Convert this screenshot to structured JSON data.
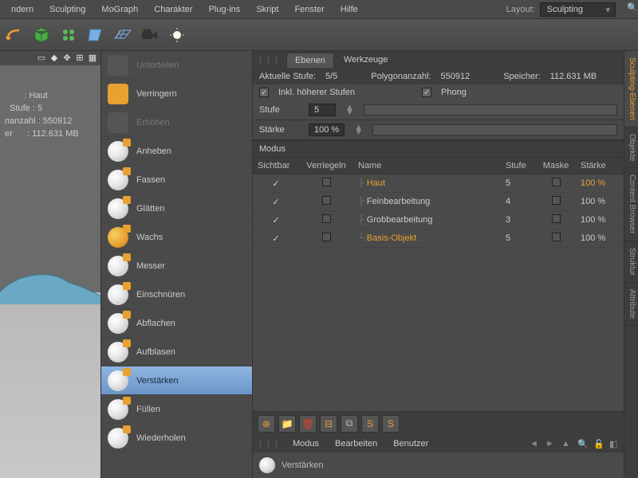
{
  "menu": [
    "ndern",
    "Sculpting",
    "MoGraph",
    "Charakter",
    "Plug-ins",
    "Skript",
    "Fenster",
    "Hilfe"
  ],
  "layout": {
    "label": "Layout:",
    "value": "Sculpting"
  },
  "viewport_info": {
    "l1": "        : Haut",
    "l2": "  Stufe : 5",
    "l3": "nanzahl : 550912",
    "l4": "er      : 112.631 MB"
  },
  "brushes": [
    {
      "label": "Unterteilen",
      "dim": true,
      "cube": true
    },
    {
      "label": "Verringern",
      "cube": true,
      "orange": true
    },
    {
      "label": "Erhöhen",
      "dim": true,
      "cube": true
    },
    {
      "label": "Anheben"
    },
    {
      "label": "Fassen"
    },
    {
      "label": "Glätten"
    },
    {
      "label": "Wachs",
      "w": true
    },
    {
      "label": "Messer"
    },
    {
      "label": "Einschnüren"
    },
    {
      "label": "Abflachen"
    },
    {
      "label": "Aufblasen"
    },
    {
      "label": "Verstärken",
      "sel": true
    },
    {
      "label": "Füllen"
    },
    {
      "label": "Wiederholen"
    }
  ],
  "tabs": {
    "t1": "Ebenen",
    "t2": "Werkzeuge"
  },
  "status": {
    "level_label": "Aktuelle Stufe:",
    "level_val": "5/5",
    "poly_label": "Polygonanzahl:",
    "poly_val": "550912",
    "mem_label": "Speicher:",
    "mem_val": "112.631 MB"
  },
  "opts": {
    "incl": "Inkl. höherer Stufen",
    "phong": "Phong",
    "stufe_label": "Stufe",
    "stufe_val": "5",
    "strength_label": "Stärke",
    "strength_val": "100 %"
  },
  "modus": "Modus",
  "headers": {
    "vis": "Sichtbar",
    "lock": "Verriegeln",
    "name": "Name",
    "lvl": "Stufe",
    "mask": "Maske",
    "str": "Stärke"
  },
  "layers": [
    {
      "name": "Haut",
      "lvl": "5",
      "str": "100 %",
      "top": true
    },
    {
      "name": "Feinbearbeitung",
      "lvl": "4",
      "str": "100 %"
    },
    {
      "name": "Grobbearbeitung",
      "lvl": "3",
      "str": "100 %"
    },
    {
      "name": "Basis-Objekt",
      "lvl": "5",
      "str": "100 %",
      "base": true
    }
  ],
  "bottom_tabs": {
    "t1": "Modus",
    "t2": "Bearbeiten",
    "t3": "Benutzer"
  },
  "bottom_brush": "Verstärken",
  "side_tabs": [
    "Sculpting-Ebenen",
    "Objekte",
    "Content Browser",
    "Struktur",
    "Attribute"
  ]
}
